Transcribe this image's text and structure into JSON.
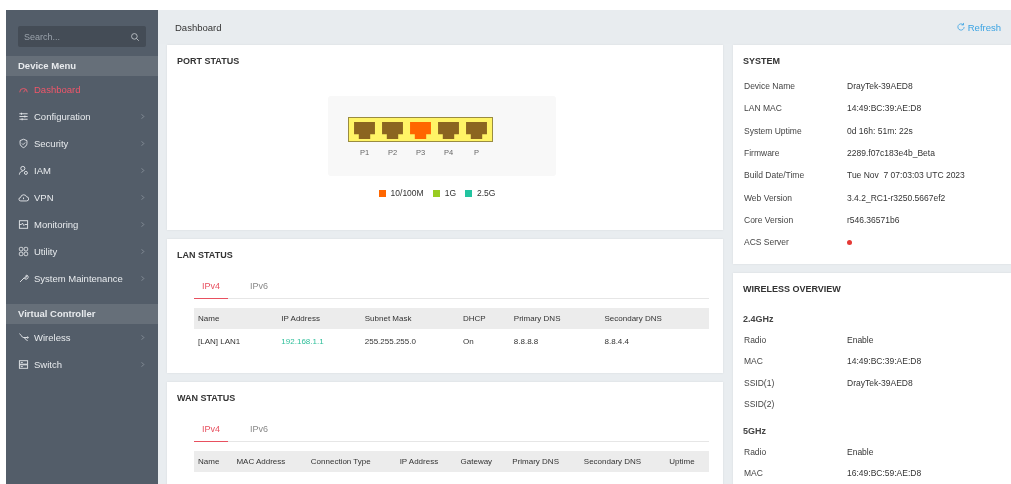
{
  "sidebar": {
    "search": {
      "placeholder": "Search..."
    },
    "sections": [
      {
        "title": "Device Menu",
        "items": [
          {
            "label": "Dashboard",
            "selected": true,
            "submenu": false
          },
          {
            "label": "Configuration",
            "selected": false,
            "submenu": true
          },
          {
            "label": "Security",
            "selected": false,
            "submenu": true
          },
          {
            "label": "IAM",
            "selected": false,
            "submenu": true
          },
          {
            "label": "VPN",
            "selected": false,
            "submenu": true
          },
          {
            "label": "Monitoring",
            "selected": false,
            "submenu": true
          },
          {
            "label": "Utility",
            "selected": false,
            "submenu": true
          },
          {
            "label": "System Maintenance",
            "selected": false,
            "submenu": true
          }
        ]
      },
      {
        "title": "Virtual Controller",
        "items": [
          {
            "label": "Wireless",
            "selected": false,
            "submenu": true
          },
          {
            "label": "Switch",
            "selected": false,
            "submenu": true
          }
        ]
      }
    ]
  },
  "header": {
    "title": "Dashboard",
    "refresh": "Refresh"
  },
  "port_status": {
    "title": "PORT STATUS",
    "ports": [
      {
        "label": "P1",
        "color": "#8b6520"
      },
      {
        "label": "P2",
        "color": "#8b6520"
      },
      {
        "label": "P3",
        "color": "#ff6600"
      },
      {
        "label": "P4",
        "color": "#8b6520"
      },
      {
        "label": "P",
        "color": "#8b6520"
      }
    ],
    "legend": [
      {
        "label": "10/100M",
        "color": "#ff6600"
      },
      {
        "label": "1G",
        "color": "#99cc22"
      },
      {
        "label": "2.5G",
        "color": "#22c4a0"
      }
    ]
  },
  "lan_status": {
    "title": "LAN STATUS",
    "tabs": [
      {
        "label": "IPv4",
        "selected": true
      },
      {
        "label": "IPv6",
        "selected": false
      }
    ],
    "columns": [
      "Name",
      "IP Address",
      "Subnet Mask",
      "DHCP",
      "Primary DNS",
      "Secondary DNS"
    ],
    "rows": [
      [
        {
          "text": "[LAN] LAN1"
        },
        {
          "text": "192.168.1.1",
          "kind": "link"
        },
        {
          "text": "255.255.255.0"
        },
        {
          "text": "On"
        },
        {
          "text": "8.8.8.8"
        },
        {
          "text": "8.8.4.4"
        }
      ]
    ]
  },
  "wan_status": {
    "title": "WAN STATUS",
    "tabs": [
      {
        "label": "IPv4",
        "selected": true
      },
      {
        "label": "IPv6",
        "selected": false
      }
    ],
    "columns": [
      "Name",
      "MAC Address",
      "Connection Type",
      "IP Address",
      "Gateway",
      "Primary DNS",
      "Secondary DNS",
      "Uptime"
    ]
  },
  "system": {
    "title": "SYSTEM",
    "rows": [
      {
        "label": "Device Name",
        "kind": "text",
        "value": "DrayTek-39AED8"
      },
      {
        "label": "LAN MAC",
        "kind": "text",
        "value": "14:49:BC:39:AE:D8"
      },
      {
        "label": "System Uptime",
        "kind": "text",
        "value": "0d 16h: 51m: 22s"
      },
      {
        "label": "Firmware",
        "kind": "text",
        "value": "2289.f07c183e4b_Beta"
      },
      {
        "label": "Build Date/Time",
        "kind": "text",
        "value": "Tue Nov  7 07:03:03 UTC 2023"
      },
      {
        "label": "Web Version",
        "kind": "text",
        "value": "3.4.2_RC1-r3250.5667ef2"
      },
      {
        "label": "Core Version",
        "kind": "text",
        "value": "r546.36571b6"
      },
      {
        "label": "ACS Server",
        "kind": "dot",
        "color": "#e53935"
      }
    ]
  },
  "wireless_overview": {
    "title": "WIRELESS OVERVIEW",
    "bands": [
      {
        "title": "2.4GHz",
        "rows": [
          {
            "label": "Radio",
            "value": "Enable"
          },
          {
            "label": "MAC",
            "value": "14:49:BC:39:AE:D8"
          },
          {
            "label": "SSID(1)",
            "value": "DrayTek-39AED8"
          },
          {
            "label": "SSID(2)"
          }
        ]
      },
      {
        "title": "5GHz",
        "rows": [
          {
            "label": "Radio",
            "value": "Enable"
          },
          {
            "label": "MAC",
            "value": "16:49:BC:59:AE:D8"
          }
        ]
      }
    ]
  }
}
